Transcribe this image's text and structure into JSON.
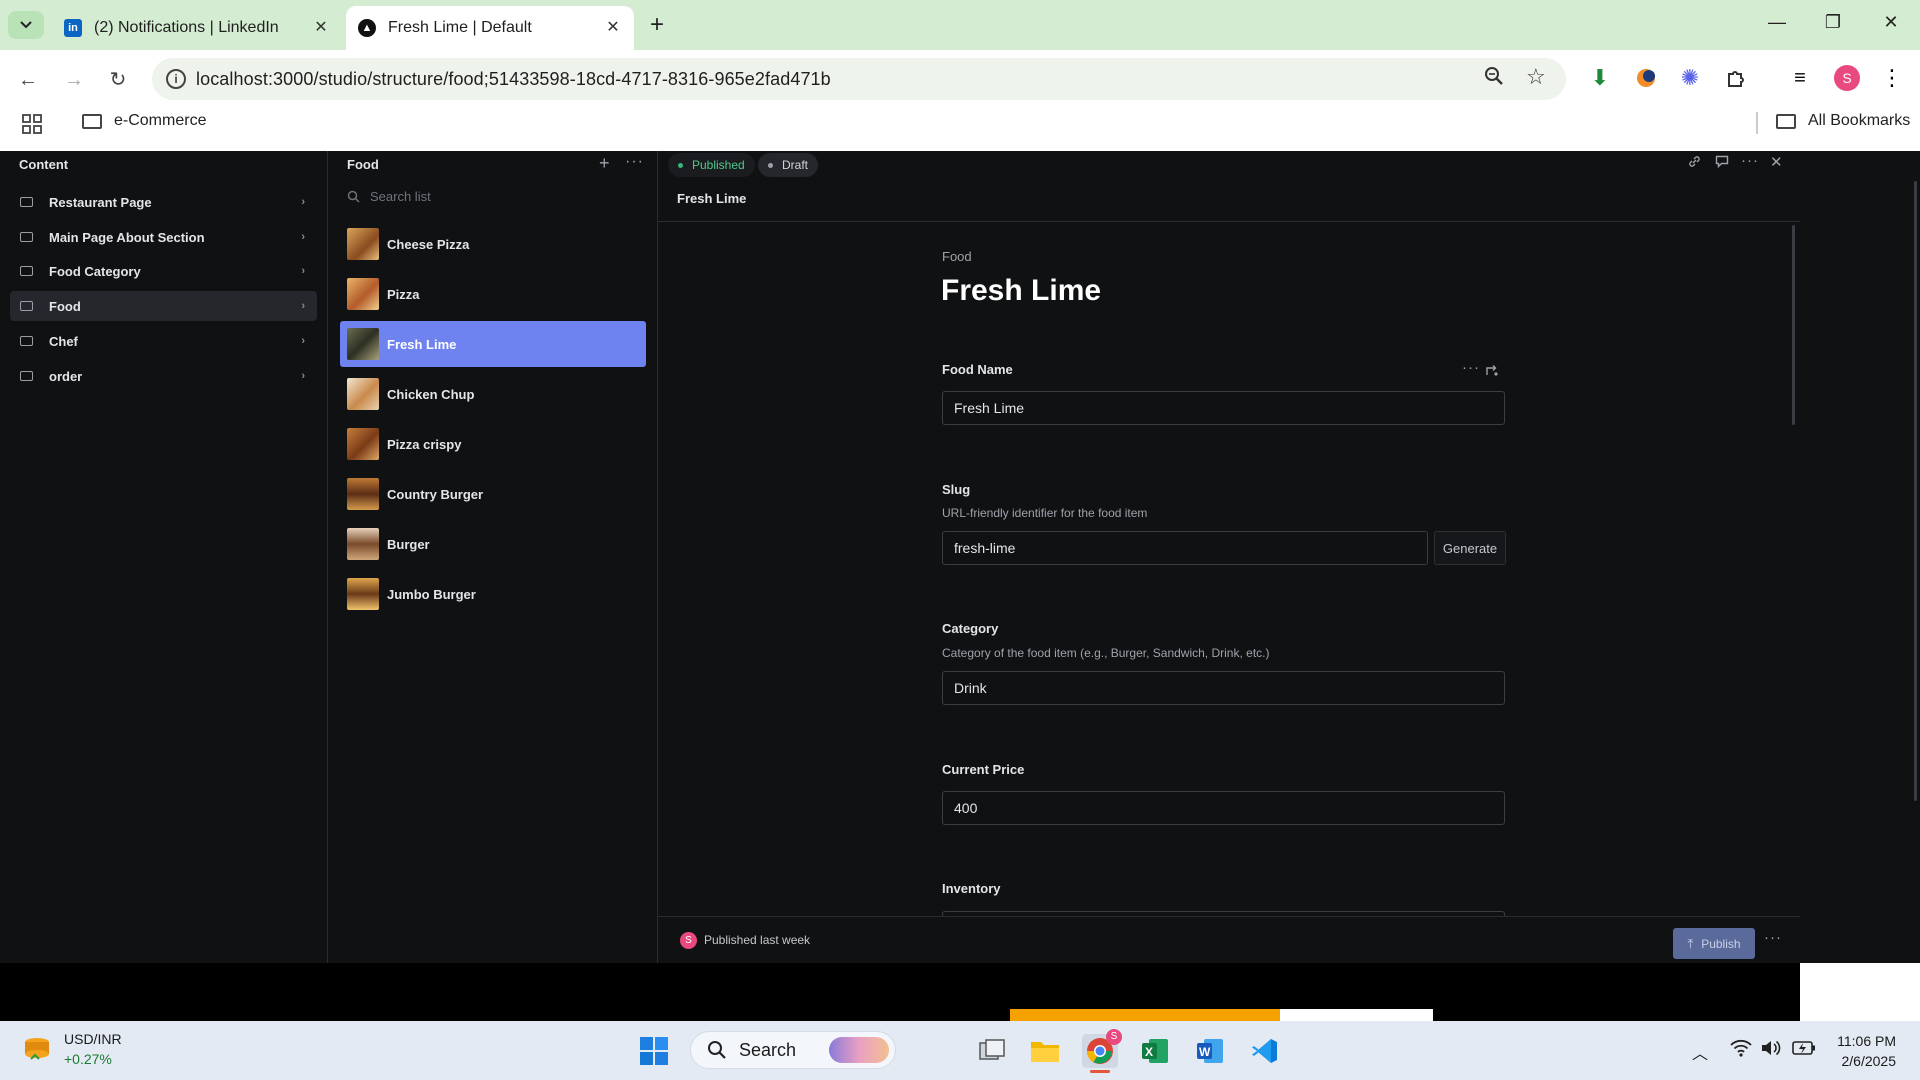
{
  "browser": {
    "tabs": [
      {
        "title": "(2) Notifications | LinkedIn",
        "favicon": "in"
      },
      {
        "title": "Fresh Lime | Default",
        "favicon": "sanity"
      }
    ],
    "url": "localhost:3000/studio/structure/food;51433598-18cd-4717-8316-965e2fad471b",
    "bookmarks": {
      "left": "e-Commerce",
      "right": "All Bookmarks"
    },
    "profile_initial": "S"
  },
  "content_pane": {
    "title": "Content",
    "items": [
      {
        "label": "Restaurant Page"
      },
      {
        "label": "Main Page About Section"
      },
      {
        "label": "Food Category"
      },
      {
        "label": "Food"
      },
      {
        "label": "Chef"
      },
      {
        "label": "order"
      }
    ]
  },
  "food_pane": {
    "title": "Food",
    "search_placeholder": "Search list",
    "items": [
      {
        "label": "Cheese Pizza"
      },
      {
        "label": "Pizza"
      },
      {
        "label": "Fresh Lime"
      },
      {
        "label": "Chicken Chup"
      },
      {
        "label": "Pizza crispy"
      },
      {
        "label": "Country Burger"
      },
      {
        "label": "Burger"
      },
      {
        "label": "Jumbo Burger"
      }
    ]
  },
  "document": {
    "status_published": "Published",
    "status_draft": "Draft",
    "breadcrumb_title": "Fresh Lime",
    "type_label": "Food",
    "title": "Fresh Lime",
    "fields": {
      "food_name": {
        "label": "Food Name",
        "value": "Fresh Lime"
      },
      "slug": {
        "label": "Slug",
        "description": "URL-friendly identifier for the food item",
        "value": "fresh-lime",
        "button": "Generate"
      },
      "category": {
        "label": "Category",
        "description": "Category of the food item (e.g., Burger, Sandwich, Drink, etc.)",
        "value": "Drink"
      },
      "current_price": {
        "label": "Current Price",
        "value": "400"
      },
      "inventory": {
        "label": "Inventory"
      }
    },
    "footer": {
      "status": "Published last week",
      "avatar_initial": "S",
      "publish_label": "Publish"
    }
  },
  "taskbar": {
    "widget": {
      "title": "USD/INR",
      "change": "+0.27%"
    },
    "search_label": "Search",
    "time": "11:06 PM",
    "date": "2/6/2025"
  },
  "colors": {
    "accent_selected": "#6e82f0",
    "published_dot": "#3ab67a",
    "publish_button": "#5a6a9a"
  }
}
